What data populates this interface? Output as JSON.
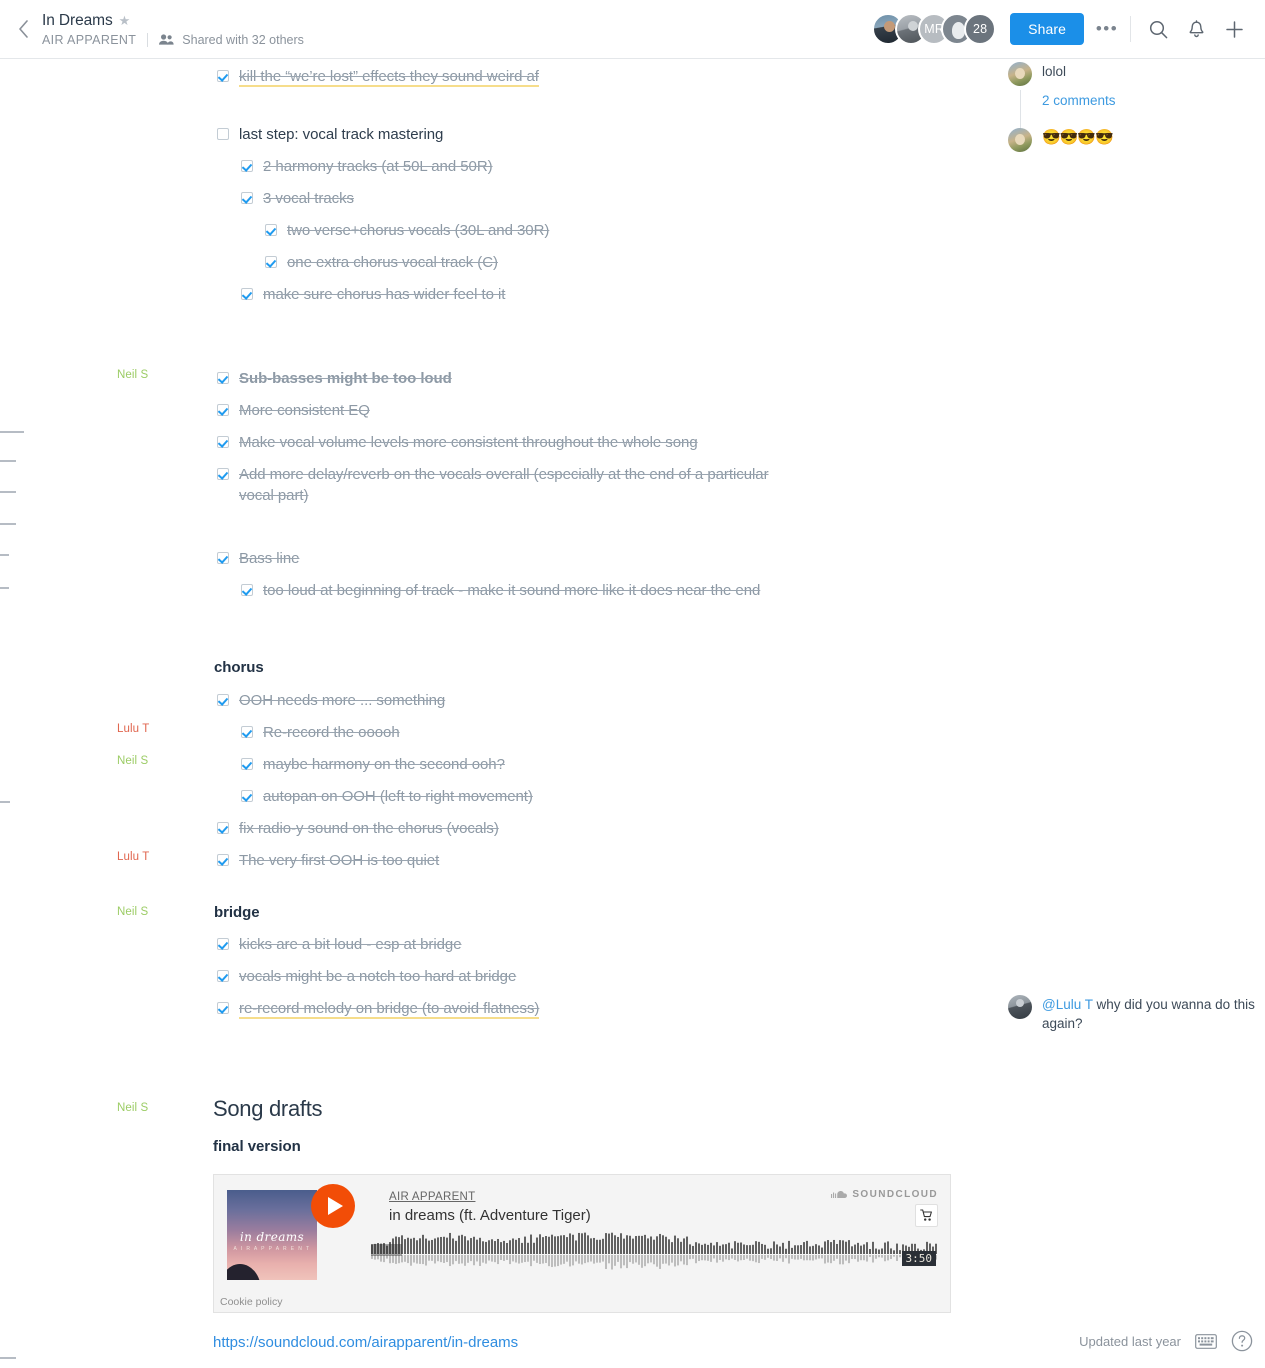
{
  "topbar": {
    "back_icon": "chevron-left-icon",
    "title": "In Dreams",
    "star_icon": "star-icon",
    "org": "AIR APPARENT",
    "people_icon": "people-icon",
    "shared_text": "Shared with 32 others",
    "avatars": [
      {
        "name": "avatar-person-1",
        "label": ""
      },
      {
        "name": "avatar-person-2",
        "label": ""
      },
      {
        "name": "avatar-initials-mr",
        "label": "MR"
      },
      {
        "name": "avatar-person-4",
        "label": ""
      },
      {
        "name": "avatar-overflow-count",
        "label": "28"
      }
    ],
    "share_label": "Share",
    "more_label": "•••",
    "search_icon": "search-icon",
    "bell_icon": "bell-icon",
    "plus_icon": "plus-icon",
    "accent_blue": "#1b8fe8"
  },
  "authors": {
    "neil": "Neil S",
    "lulu": "Lulu T",
    "neil_color": "#9ccc65",
    "lulu_color": "#e0664f"
  },
  "doc": {
    "items": [
      {
        "id": "kill-effects",
        "text": "kill the “we’re lost” effects they sound weird af",
        "checked": true,
        "done": true,
        "highlight": true,
        "indent": 0
      },
      {
        "id": "vocal-mastering",
        "text": "last step: vocal track mastering",
        "checked": false,
        "done": false,
        "highlight": false,
        "indent": 0
      },
      {
        "id": "harmony-tracks",
        "text": "2 harmony tracks (at 50L and 50R)",
        "checked": true,
        "done": true,
        "highlight": false,
        "indent": 1
      },
      {
        "id": "vocal-tracks",
        "text": "3 vocal tracks",
        "checked": true,
        "done": true,
        "highlight": false,
        "indent": 1
      },
      {
        "id": "verse-chorus-vocals",
        "text": "two verse+chorus vocals (30L and 30R)",
        "checked": true,
        "done": true,
        "highlight": false,
        "indent": 2
      },
      {
        "id": "extra-chorus-vocal",
        "text": "one extra chorus vocal track (C)",
        "checked": true,
        "done": true,
        "highlight": false,
        "indent": 2
      },
      {
        "id": "chorus-wider-feel",
        "text": "make sure chorus has wider feel to it",
        "checked": true,
        "done": true,
        "highlight": false,
        "indent": 1
      },
      {
        "id": "sub-basses",
        "text": "Sub-basses might be too loud",
        "checked": true,
        "done": true,
        "highlight": false,
        "indent": 0,
        "bold": true,
        "author": "neil"
      },
      {
        "id": "consistent-eq",
        "text": "More consistent EQ",
        "checked": true,
        "done": true,
        "highlight": false,
        "indent": 0
      },
      {
        "id": "vocal-volume-levels",
        "text": "Make vocal volume levels more consistent throughout the whole song",
        "checked": true,
        "done": true,
        "highlight": false,
        "indent": 0
      },
      {
        "id": "delay-reverb",
        "text": "Add more delay/reverb on the vocals overall (especially at the end of a particular vocal part)",
        "checked": true,
        "done": true,
        "highlight": false,
        "indent": 0
      },
      {
        "id": "bass-line",
        "text": "Bass line",
        "checked": true,
        "done": true,
        "highlight": false,
        "indent": 0
      },
      {
        "id": "bass-too-loud",
        "text": "too loud at beginning of track - make it sound more like it does near the end",
        "checked": true,
        "done": true,
        "highlight": false,
        "indent": 1
      },
      {
        "id": "ooh-needs-more",
        "text": "OOH needs more ... something",
        "checked": true,
        "done": true,
        "highlight": false,
        "indent": 0
      },
      {
        "id": "re-record-ooooh",
        "text": "Re-record the ooooh",
        "checked": true,
        "done": true,
        "highlight": false,
        "indent": 1,
        "author": "lulu"
      },
      {
        "id": "harmony-second-ooh",
        "text": "maybe harmony on the second ooh?",
        "checked": true,
        "done": true,
        "highlight": false,
        "indent": 1,
        "author": "neil"
      },
      {
        "id": "autopan-ooh",
        "text": "autopan on OOH (left to right movement)",
        "checked": true,
        "done": true,
        "highlight": false,
        "indent": 1
      },
      {
        "id": "fix-radio-sound",
        "text": "fix radio-y sound on the chorus (vocals)",
        "checked": true,
        "done": true,
        "highlight": false,
        "indent": 0
      },
      {
        "id": "first-ooh-quiet",
        "text": "The very first OOH is too quiet",
        "checked": true,
        "done": true,
        "highlight": false,
        "indent": 0,
        "author": "lulu"
      },
      {
        "id": "kicks-loud-bridge",
        "text": "kicks are a bit loud - esp at bridge",
        "checked": true,
        "done": true,
        "highlight": false,
        "indent": 0
      },
      {
        "id": "vocals-hard-bridge",
        "text": "vocals might be a notch too hard at bridge",
        "checked": true,
        "done": true,
        "highlight": false,
        "indent": 0
      },
      {
        "id": "re-record-melody",
        "text": "re-record melody on bridge (to avoid flatness)",
        "checked": true,
        "done": true,
        "highlight": true,
        "indent": 0
      }
    ],
    "heading_chorus": "chorus",
    "heading_bridge": "bridge",
    "heading_song_drafts": "Song drafts",
    "heading_final_version": "final version",
    "link": "https://soundcloud.com/airapparent/in-dreams"
  },
  "comments": [
    {
      "id": "comment-lolol",
      "avatar": "avatar-comment-park",
      "text": "lolol",
      "replies_label": "2 comments"
    },
    {
      "id": "comment-sunglasses",
      "avatar": "avatar-comment-park",
      "text": "😎😎😎😎"
    },
    {
      "id": "comment-why-again",
      "avatar": "avatar-comment-man",
      "mention": "@Lulu T",
      "text": " why did you wanna do this again?"
    }
  ],
  "soundcloud": {
    "artist": "AIR APPARENT",
    "track": "in dreams  (ft. Adventure Tiger)",
    "art_title": "in dreams",
    "art_subtitle": "A I R  A P P A R E N T",
    "brand": "SOUNDCLOUD",
    "brand_icon": "soundcloud-cloud-icon",
    "cart_icon": "cart-icon",
    "play_icon": "play-icon",
    "duration": "3:50",
    "cookie_policy": "Cookie policy"
  },
  "footer": {
    "updated": "Updated last year",
    "keyboard_icon": "keyboard-icon",
    "help_icon": "help-circle-icon"
  }
}
